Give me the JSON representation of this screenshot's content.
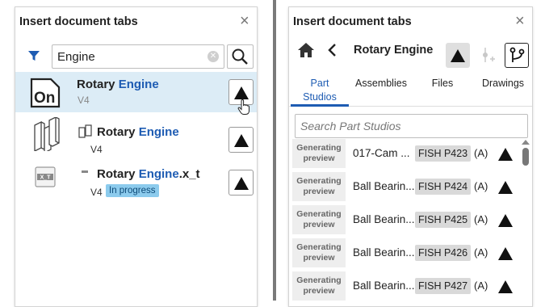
{
  "left_panel": {
    "title": "Insert document tabs",
    "close_glyph": "×",
    "search": {
      "value": "Engine",
      "placeholder": ""
    },
    "documents": [
      {
        "name_prefix": "Rotary ",
        "name_match": "Engine",
        "name_suffix": "",
        "version": "V4",
        "icon": "onshape-logo-icon",
        "selected": true
      },
      {
        "name_prefix": "Rotary ",
        "name_match": "Engine",
        "name_suffix": "",
        "version": "V4",
        "icon": "assembly-icon",
        "sub_icon": "part-copy-icon"
      },
      {
        "name_prefix": "Rotary ",
        "name_match": "Engine",
        "name_suffix": ".x_t",
        "version": "V4",
        "status": "In progress",
        "icon": "x-t-file-icon",
        "sub_icon": "minus-icon"
      }
    ]
  },
  "right_panel": {
    "title": "Insert document tabs",
    "close_glyph": "×",
    "document_title": "Rotary Engine",
    "tabs": [
      {
        "label_line1": "Part",
        "label_line2": "Studios",
        "active": true
      },
      {
        "label_line1": "Assemblies",
        "label_line2": ""
      },
      {
        "label_line1": "Files",
        "label_line2": ""
      },
      {
        "label_line1": "Drawings",
        "label_line2": ""
      }
    ],
    "search_placeholder": "Search Part Studios",
    "thumb_text_line1": "Generating",
    "thumb_text_line2": "preview",
    "part_studios": [
      {
        "name": "017-Cam ...",
        "number": "FISH P423",
        "rev": "(A)"
      },
      {
        "name": "Ball Bearin...",
        "number": "FISH P424",
        "rev": "(A)"
      },
      {
        "name": "Ball Bearin...",
        "number": "FISH P425",
        "rev": "(A)"
      },
      {
        "name": "Ball Bearin...",
        "number": "FISH P426",
        "rev": "(A)"
      },
      {
        "name": "Ball Bearin...",
        "number": "FISH P427",
        "rev": "(A)"
      }
    ]
  },
  "colors": {
    "accent": "#1e5cb3",
    "selected_row": "#dcecf6",
    "in_progress_badge": "#8ccbed",
    "separator": "#7a7a7a"
  }
}
